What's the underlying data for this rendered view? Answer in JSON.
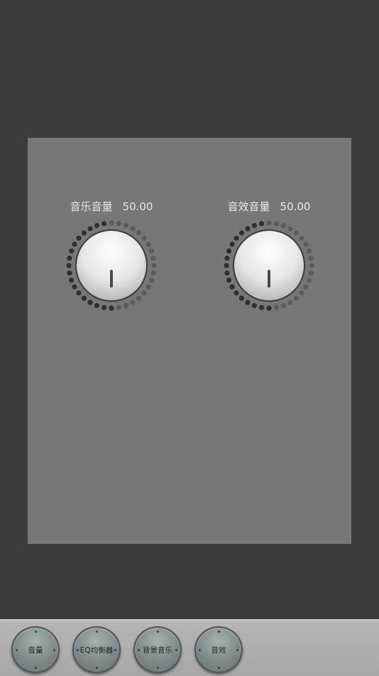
{
  "knobs": [
    {
      "label": "音乐音量",
      "value": "50.00",
      "level": 0.5
    },
    {
      "label": "音效音量",
      "value": "50.00",
      "level": 0.5
    }
  ],
  "tabs": [
    {
      "label": "音量"
    },
    {
      "label": "EQ均衡器"
    },
    {
      "label": "背景音乐"
    },
    {
      "label": "音效"
    }
  ],
  "colors": {
    "background": "#3d3d3d",
    "panel": "#777777",
    "dot_active": "#2f2f2f",
    "dot_inactive": "#5c5c5c",
    "label_text": "#e8e8e8",
    "bottom_bar": "#afafaf",
    "tab_button": "#7e8a8a"
  }
}
